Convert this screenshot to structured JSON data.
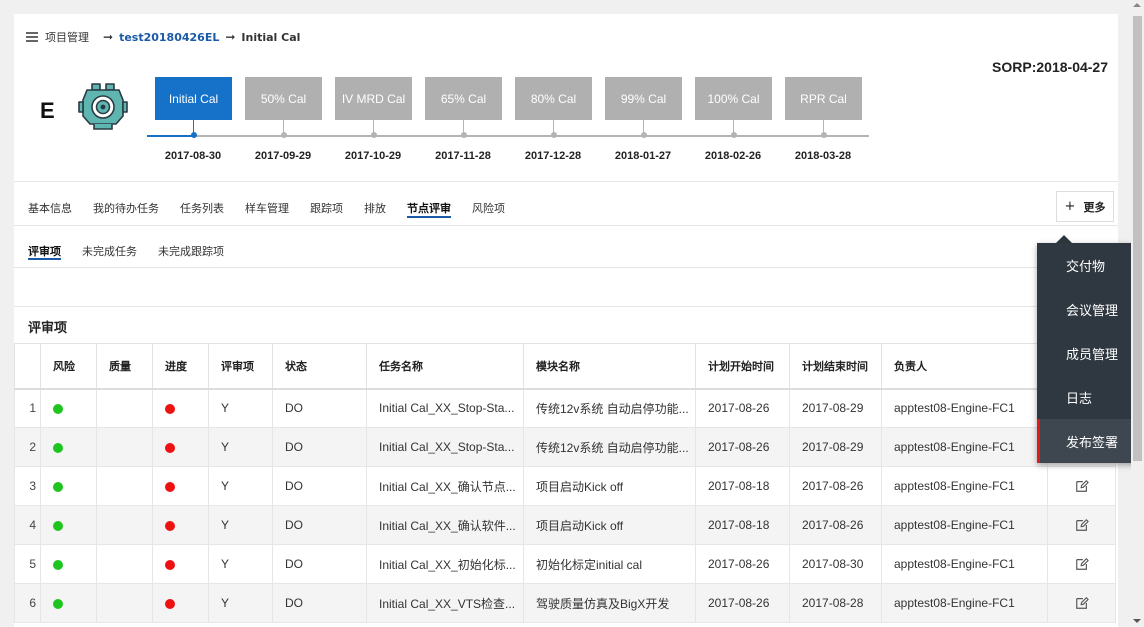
{
  "breadcrumb": {
    "root": "项目管理",
    "project": "test20180426EL",
    "current": "Initial Cal",
    "arrow": "➞"
  },
  "sorp": "SORP:2018-04-27",
  "grade": "E",
  "milestones": [
    {
      "label": "Initial Cal",
      "date": "2017-08-30",
      "active": true
    },
    {
      "label": "50% Cal",
      "date": "2017-09-29",
      "active": false
    },
    {
      "label": "IV MRD Cal",
      "date": "2017-10-29",
      "active": false
    },
    {
      "label": "65% Cal",
      "date": "2017-11-28",
      "active": false
    },
    {
      "label": "80% Cal",
      "date": "2017-12-28",
      "active": false
    },
    {
      "label": "99% Cal",
      "date": "2018-01-27",
      "active": false
    },
    {
      "label": "100% Cal",
      "date": "2018-02-26",
      "active": false
    },
    {
      "label": "RPR Cal",
      "date": "2018-03-28",
      "active": false
    }
  ],
  "tabs": [
    "基本信息",
    "我的待办任务",
    "任务列表",
    "样车管理",
    "跟踪项",
    "排放",
    "节点评审",
    "风险项"
  ],
  "active_tab": "节点评审",
  "more_button": {
    "plus": "+",
    "label": "更多"
  },
  "subtabs": [
    "评审项",
    "未完成任务",
    "未完成跟踪项"
  ],
  "active_subtab": "评审项",
  "section_title": "评审项",
  "table": {
    "headers": [
      "",
      "风险",
      "质量",
      "进度",
      "评审项",
      "状态",
      "任务名称",
      "模块名称",
      "计划开始时间",
      "计划结束时间",
      "负责人",
      ""
    ],
    "rows": [
      {
        "no": "1",
        "risk": "green",
        "progress": "red",
        "review": "Y",
        "status": "DO",
        "task": "Initial Cal_XX_Stop-Sta...",
        "module": "传统12v系统 自动启停功能...",
        "start": "2017-08-26",
        "end": "2017-08-29",
        "owner": "apptest08-Engine-FC1"
      },
      {
        "no": "2",
        "risk": "green",
        "progress": "red",
        "review": "Y",
        "status": "DO",
        "task": "Initial Cal_XX_Stop-Sta...",
        "module": "传统12v系统 自动启停功能...",
        "start": "2017-08-26",
        "end": "2017-08-29",
        "owner": "apptest08-Engine-FC1"
      },
      {
        "no": "3",
        "risk": "green",
        "progress": "red",
        "review": "Y",
        "status": "DO",
        "task": "Initial Cal_XX_确认节点...",
        "module": "项目启动Kick off",
        "start": "2017-08-18",
        "end": "2017-08-26",
        "owner": "apptest08-Engine-FC1"
      },
      {
        "no": "4",
        "risk": "green",
        "progress": "red",
        "review": "Y",
        "status": "DO",
        "task": "Initial Cal_XX_确认软件...",
        "module": "项目启动Kick off",
        "start": "2017-08-18",
        "end": "2017-08-26",
        "owner": "apptest08-Engine-FC1"
      },
      {
        "no": "5",
        "risk": "green",
        "progress": "red",
        "review": "Y",
        "status": "DO",
        "task": "Initial Cal_XX_初始化标...",
        "module": "初始化标定initial cal",
        "start": "2017-08-26",
        "end": "2017-08-30",
        "owner": "apptest08-Engine-FC1"
      },
      {
        "no": "6",
        "risk": "green",
        "progress": "red",
        "review": "Y",
        "status": "DO",
        "task": "Initial Cal_XX_VTS检查...",
        "module": "驾驶质量仿真及BigX开发",
        "start": "2017-08-26",
        "end": "2017-08-28",
        "owner": "apptest08-Engine-FC1"
      }
    ]
  },
  "menu": [
    "交付物",
    "会议管理",
    "成员管理",
    "日志",
    "发布签署"
  ],
  "menu_highlighted": "发布签署",
  "colors": {
    "accent": "#1572c8",
    "milestone_inactive": "#b0b0b0",
    "menu_bg": "#2f3840",
    "menu_marker": "#e01b1b",
    "ok": "#1fc51f",
    "bad": "#ee1111"
  }
}
